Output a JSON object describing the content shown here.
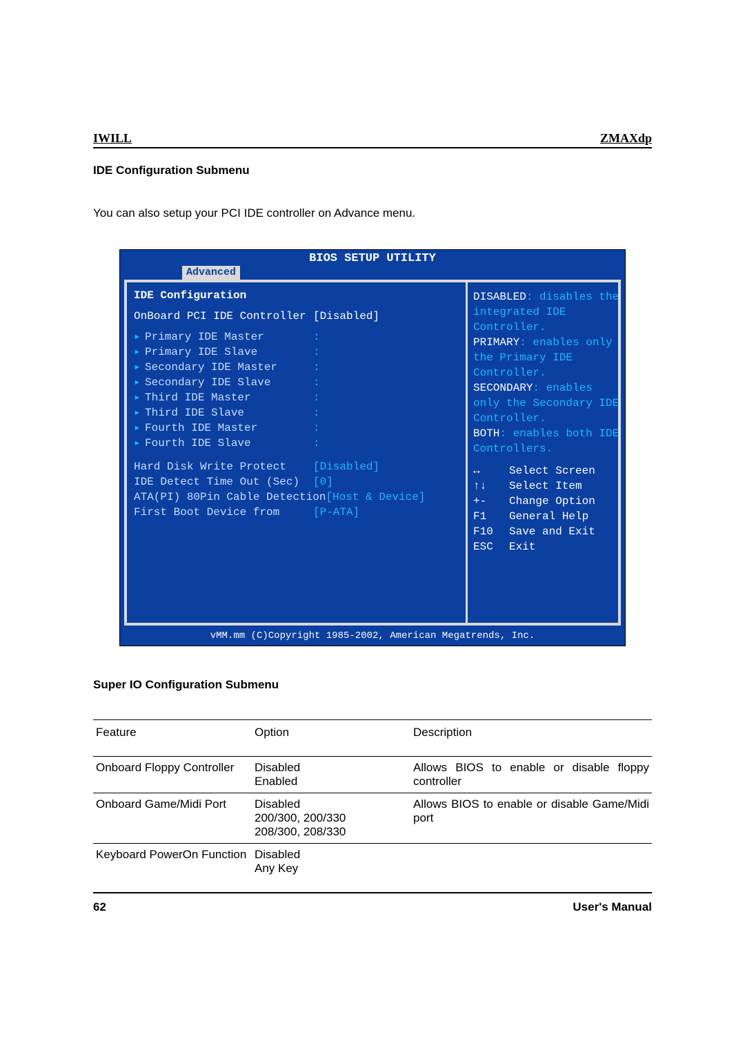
{
  "header": {
    "left": "IWILL",
    "right": "ZMAXdp"
  },
  "section1": {
    "title": "IDE Configuration Submenu",
    "body": "You can also setup your PCI IDE controller on Advance menu."
  },
  "bios": {
    "title": "BIOS SETUP UTILITY",
    "tab": "Advanced",
    "panel_title": "IDE Configuration",
    "main_option": {
      "label": "OnBoard PCI IDE Controller",
      "value": "[Disabled]"
    },
    "submenus": [
      {
        "label": "Primary IDE Master",
        "value": ":"
      },
      {
        "label": "Primary IDE Slave",
        "value": ":"
      },
      {
        "label": "Secondary IDE Master",
        "value": ":"
      },
      {
        "label": "Secondary IDE Slave",
        "value": ":"
      },
      {
        "label": "Third IDE Master",
        "value": ":"
      },
      {
        "label": "Third IDE Slave",
        "value": ":"
      },
      {
        "label": "Fourth IDE Master",
        "value": ":"
      },
      {
        "label": "Fourth IDE Slave",
        "value": ":"
      }
    ],
    "extras": [
      {
        "label": "Hard Disk Write Protect",
        "value": "[Disabled]"
      },
      {
        "label": "IDE Detect Time Out (Sec)",
        "value": "[0]"
      },
      {
        "label": "ATA(PI) 80Pin Cable Detection",
        "value": "[Host & Device]"
      },
      {
        "label": "First Boot Device from",
        "value": "[P-ATA]"
      }
    ],
    "help": {
      "l1a": "DISABLED",
      "l1b": ": disables the",
      "l2": "integrated IDE",
      "l3": "Controller.",
      "l4a": "PRIMARY",
      "l4b": ": enables only",
      "l5": "the Primary IDE",
      "l6": "Controller.",
      "l7a": "SECONDARY",
      "l7b": ": enables",
      "l8": "only the Secondary IDE",
      "l9": "Controller.",
      "l10a": "BOTH",
      "l10b": ": enables both IDE",
      "l11": "Controllers."
    },
    "nav": [
      {
        "key": "↔",
        "action": "Select Screen"
      },
      {
        "key": "↑↓",
        "action": "Select Item"
      },
      {
        "key": "+-",
        "action": "Change Option"
      },
      {
        "key": "F1",
        "action": "General Help"
      },
      {
        "key": "F10",
        "action": "Save and Exit"
      },
      {
        "key": "ESC",
        "action": "Exit"
      }
    ],
    "copyright": "vMM.mm (C)Copyright 1985-2002, American Megatrends, Inc."
  },
  "section2": {
    "title": "Super IO Configuration Submenu"
  },
  "table": {
    "headers": {
      "feature": "Feature",
      "option": "Option",
      "description": "Description"
    },
    "rows": [
      {
        "feature": "Onboard Floppy Controller",
        "option": "Disabled\nEnabled",
        "description": "Allows BIOS to enable or disable floppy controller"
      },
      {
        "feature": "Onboard Game/Midi Port",
        "option": "Disabled\n200/300, 200/330\n208/300, 208/330",
        "description": "Allows BIOS to enable or disable Game/Midi port"
      },
      {
        "feature": "Keyboard PowerOn Function",
        "option": "Disabled\nAny Key",
        "description": ""
      }
    ]
  },
  "footer": {
    "page": "62",
    "manual": "User's  Manual"
  }
}
